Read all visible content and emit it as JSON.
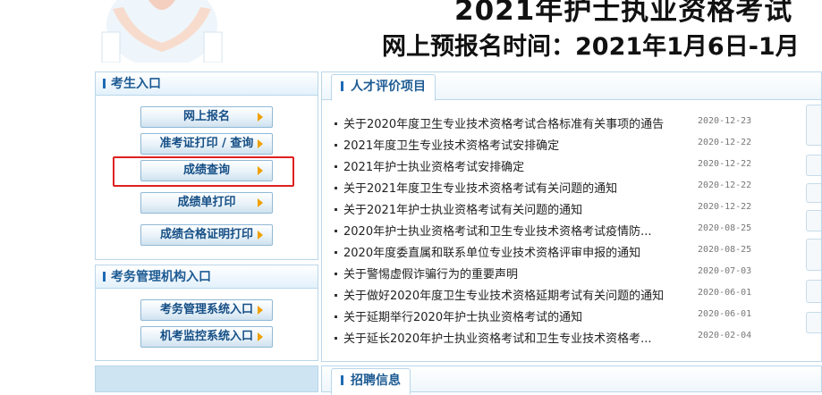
{
  "banner": {
    "title": "2021年护士执业资格考试",
    "subtitle": "网上预报名时间：2021年1月6日-1月"
  },
  "candidate_panel": {
    "heading": "考生入口",
    "buttons": [
      "网上报名",
      "准考证打印 / 查询",
      "成绩查询",
      "成绩单打印",
      "成绩合格证明打印"
    ]
  },
  "agency_panel": {
    "heading": "考务管理机构入口",
    "buttons": [
      "考务管理系统入口",
      "机考监控系统入口"
    ]
  },
  "news": {
    "tab": "人才评价项目",
    "items": [
      {
        "title": "关于2020年度卫生专业技术资格考试合格标准有关事项的通告",
        "date": "2020-12-23"
      },
      {
        "title": "2021年度卫生专业技术资格考试安排确定",
        "date": "2020-12-22"
      },
      {
        "title": "2021年护士执业资格考试安排确定",
        "date": "2020-12-22"
      },
      {
        "title": "关于2021年度卫生专业技术资格考试有关问题的通知",
        "date": "2020-12-22"
      },
      {
        "title": "关于2021年护士执业资格考试有关问题的通知",
        "date": "2020-12-22"
      },
      {
        "title": "2020年护士执业资格考试和卫生专业技术资格考试疫情防...",
        "date": "2020-08-25"
      },
      {
        "title": "2020年度委直属和联系单位专业技术资格评审申报的通知",
        "date": "2020-08-25"
      },
      {
        "title": "关于警惕虚假诈骗行为的重要声明",
        "date": "2020-07-03"
      },
      {
        "title": "关于做好2020年度卫生专业技术资格延期考试有关问题的通知",
        "date": "2020-06-01"
      },
      {
        "title": "关于延期举行2020年护士执业资格考试的通知",
        "date": "2020-06-01"
      },
      {
        "title": "关于延长2020年护士执业资格考试和卫生专业技术资格考...",
        "date": "2020-02-04"
      }
    ]
  },
  "recruit": {
    "tab": "招聘信息"
  },
  "colors": {
    "accent_blue": "#1d5b93",
    "border_blue": "#b9d6ea",
    "arrow_orange": "#f0a000",
    "highlight_red": "#e02020"
  }
}
